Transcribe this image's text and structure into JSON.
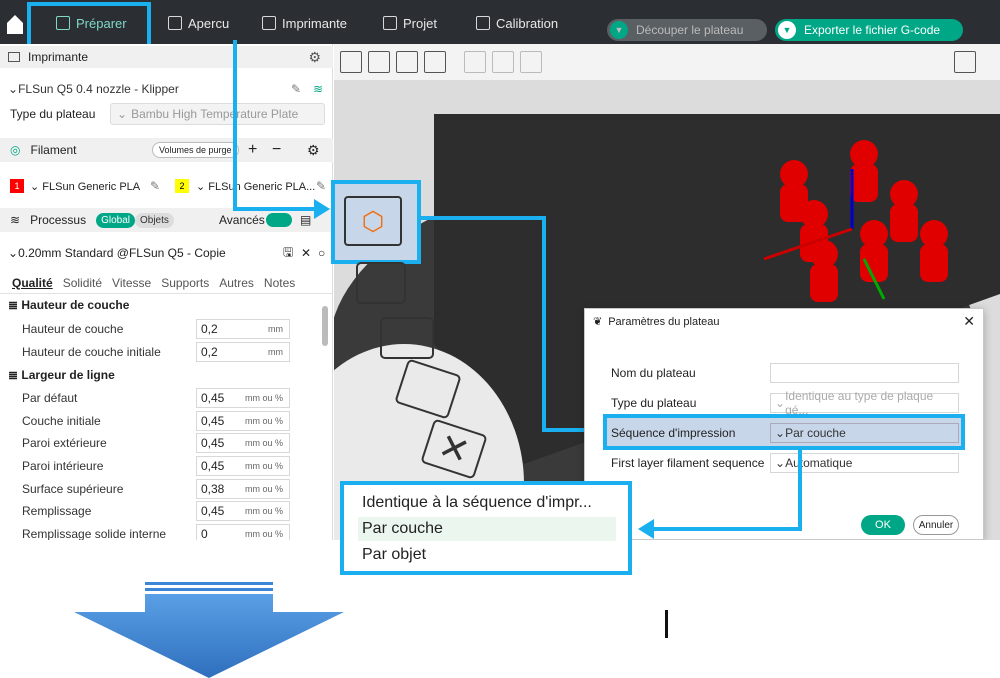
{
  "topbar": {
    "tabs": [
      {
        "label": "Préparer",
        "icon": "cube-icon"
      },
      {
        "label": "Apercu",
        "icon": "layers-icon"
      },
      {
        "label": "Imprimante",
        "icon": "printer-icon"
      },
      {
        "label": "Projet",
        "icon": "project-icon"
      },
      {
        "label": "Calibration",
        "icon": "calibration-icon"
      }
    ],
    "slice_button": "Découper le plateau",
    "export_button": "Exporter le fichier G-code"
  },
  "printer_section": {
    "title": "Imprimante",
    "printer_name": "FLSun Q5 0.4 nozzle - Klipper",
    "plate_type_label": "Type du plateau",
    "plate_type_value": "Bambu High Temperature Plate"
  },
  "filament_section": {
    "title": "Filament",
    "purge_button": "Volumes de purge",
    "filaments": [
      {
        "index": "1",
        "name": "FLSun Generic PLA",
        "color": "#ff0000"
      },
      {
        "index": "2",
        "name": "FLSun Generic PLA...",
        "color": "#ffff00"
      }
    ]
  },
  "process_section": {
    "title": "Processus",
    "toggle_global": "Global",
    "toggle_objects": "Objets",
    "advanced_label": "Avancés",
    "profile": "0.20mm Standard @FLSun Q5 - Copie",
    "tabs": [
      "Qualité",
      "Solidité",
      "Vitesse",
      "Supports",
      "Autres",
      "Notes"
    ],
    "groups": [
      {
        "title": "Hauteur de couche",
        "params": [
          {
            "label": "Hauteur de couche",
            "value": "0,2",
            "unit": "mm"
          },
          {
            "label": "Hauteur de couche initiale",
            "value": "0,2",
            "unit": "mm"
          }
        ]
      },
      {
        "title": "Largeur de ligne",
        "params": [
          {
            "label": "Par défaut",
            "value": "0,45",
            "unit": "mm ou %"
          },
          {
            "label": "Couche initiale",
            "value": "0,45",
            "unit": "mm ou %"
          },
          {
            "label": "Paroi extérieure",
            "value": "0,45",
            "unit": "mm ou %"
          },
          {
            "label": "Paroi intérieure",
            "value": "0,45",
            "unit": "mm ou %"
          },
          {
            "label": "Surface supérieure",
            "value": "0,38",
            "unit": "mm ou %"
          },
          {
            "label": "Remplissage",
            "value": "0,45",
            "unit": "mm ou %"
          },
          {
            "label": "Remplissage solide interne",
            "value": "0",
            "unit": "mm ou %"
          }
        ]
      }
    ]
  },
  "plate_dialog": {
    "title": "Paramètres du plateau",
    "fields": [
      {
        "label": "Nom du plateau",
        "value": ""
      },
      {
        "label": "Type du plateau",
        "value": "Identique au type de plaque gé..."
      },
      {
        "label": "Séquence d'impression",
        "value": "Par couche"
      },
      {
        "label": "First layer filament sequence",
        "value": "Automatique"
      }
    ],
    "ok_button": "OK",
    "cancel_button": "Annuler"
  },
  "sequence_dropdown": {
    "options": [
      "Identique à la séquence d'impr...",
      "Par couche",
      "Par objet"
    ],
    "selected": "Par couche"
  },
  "colors": {
    "accent": "#00a786",
    "highlight": "#1ab0f0",
    "topbar": "#2b2f33"
  }
}
